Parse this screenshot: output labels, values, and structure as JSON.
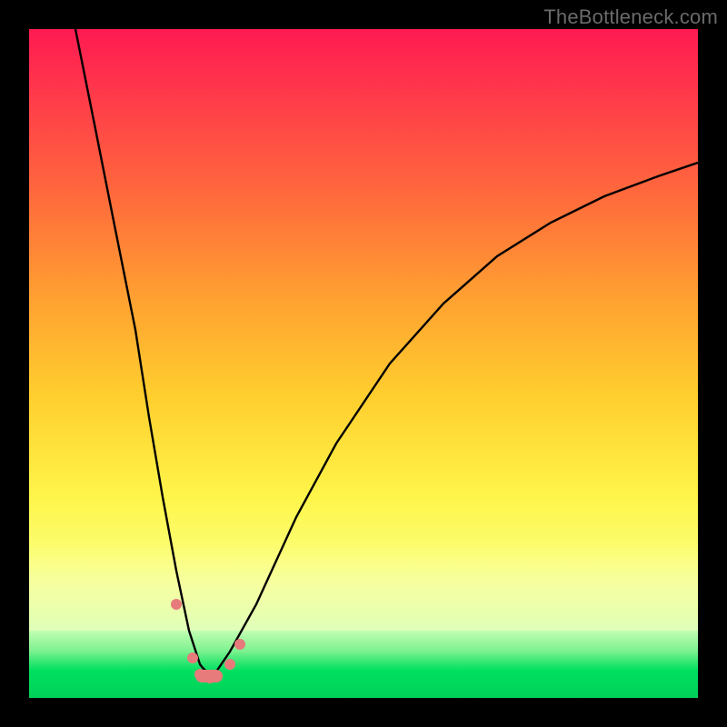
{
  "watermark": "TheBottleneck.com",
  "chart_data": {
    "type": "line",
    "title": "",
    "xlabel": "",
    "ylabel": "",
    "xlim": [
      0,
      100
    ],
    "ylim": [
      0,
      100
    ],
    "grid": false,
    "legend": false,
    "notes": "Bottleneck-style V-curve over a red→yellow→green vertical gradient. Values on the black curve are approximate percentages (low = good / green). No axis ticks or numeric labels are rendered in the image.",
    "series": [
      {
        "name": "bottleneck-curve",
        "color": "#000000",
        "x": [
          7,
          10,
          13,
          16,
          18,
          20,
          22,
          24,
          25.5,
          27,
          28,
          30,
          34,
          40,
          46,
          54,
          62,
          70,
          78,
          86,
          94,
          100
        ],
        "values": [
          100,
          85,
          70,
          55,
          42,
          30,
          19,
          10,
          5,
          3,
          4,
          7,
          14,
          27,
          38,
          50,
          59,
          66,
          71,
          75,
          78,
          80
        ]
      },
      {
        "name": "highlight-dots",
        "color": "#e77b7b",
        "x": [
          22,
          24.5,
          25.5,
          27,
          30,
          31.5
        ],
        "values": [
          14,
          6,
          3.5,
          3,
          5,
          8
        ]
      }
    ],
    "gradient_stops": [
      {
        "pct": 0,
        "color": "#ff1a52"
      },
      {
        "pct": 25,
        "color": "#ff6a3c"
      },
      {
        "pct": 55,
        "color": "#ffcf2e"
      },
      {
        "pct": 80,
        "color": "#faff7a"
      },
      {
        "pct": 100,
        "color": "#00e060"
      }
    ]
  }
}
